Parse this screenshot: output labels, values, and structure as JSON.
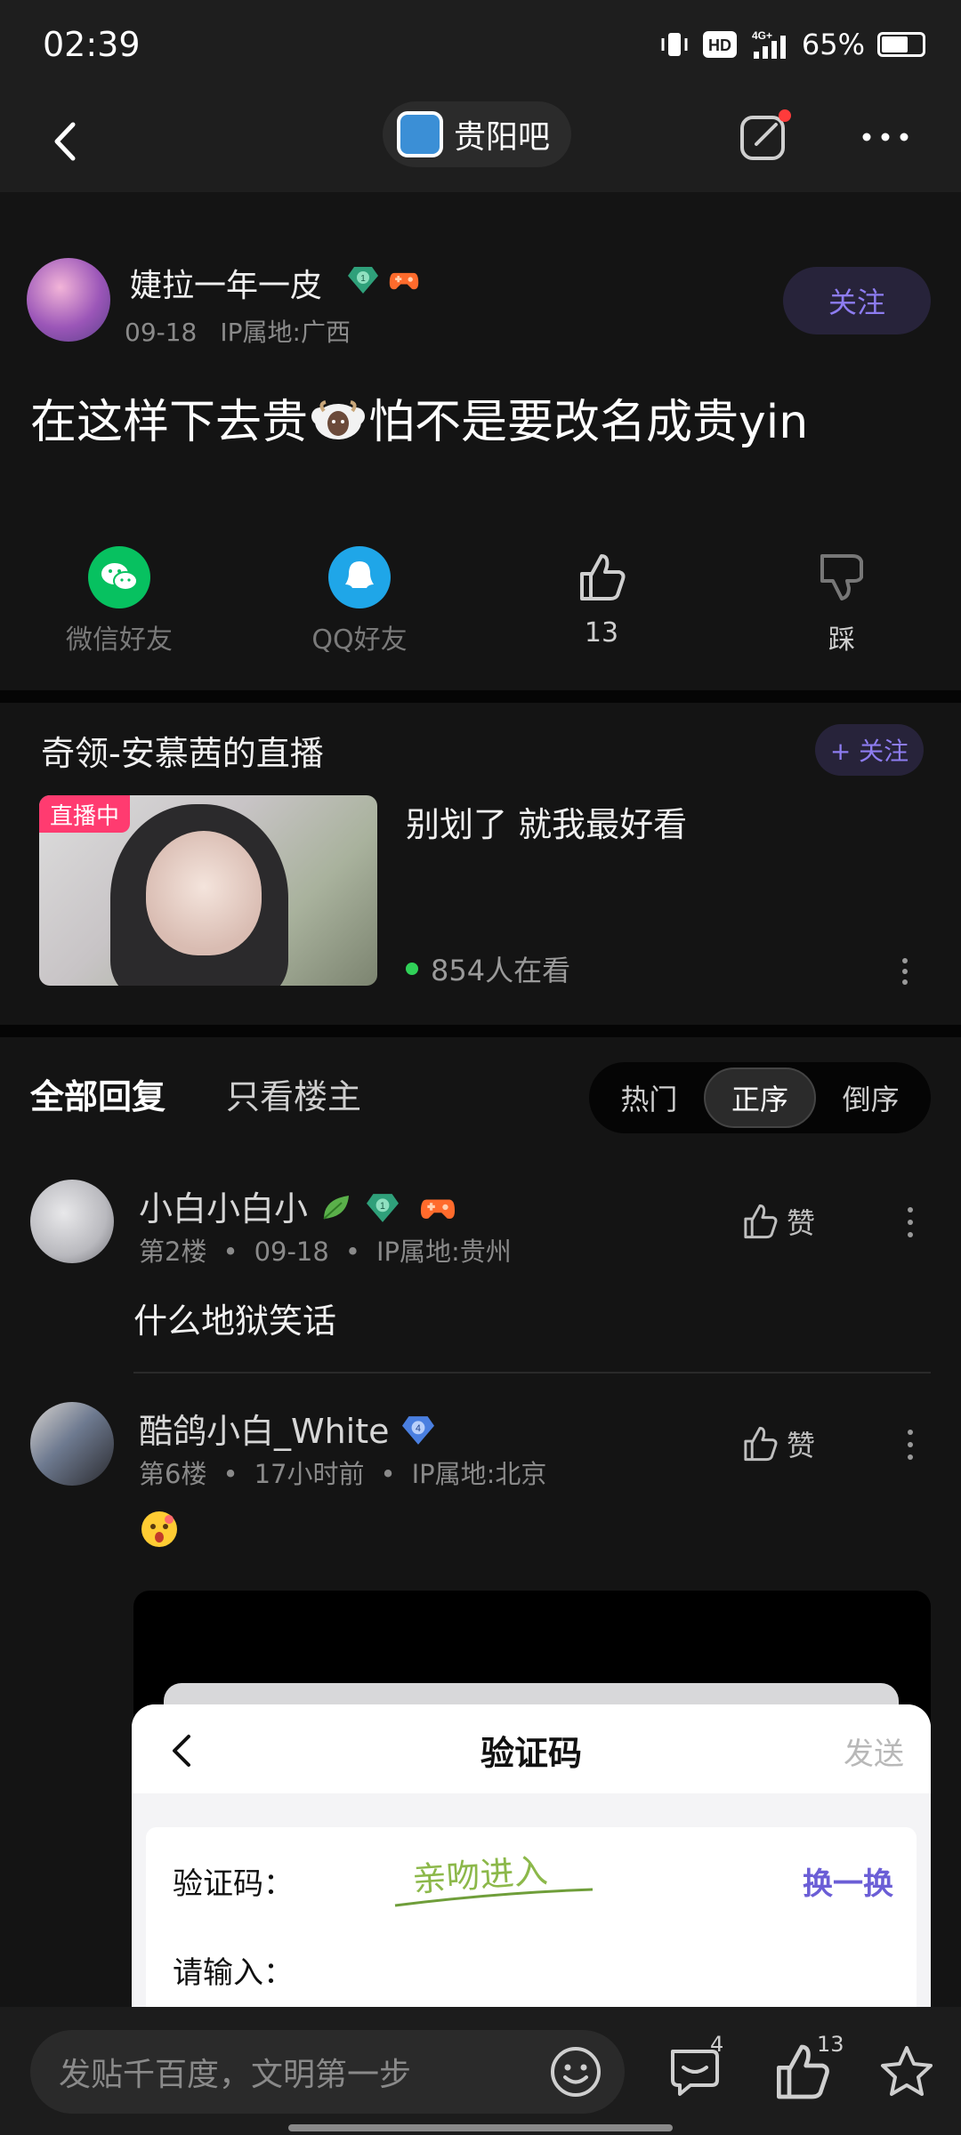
{
  "status_bar": {
    "time": "02:39",
    "network": "4G+",
    "hd": "HD",
    "battery": "65%"
  },
  "nav": {
    "forum_name": "贵阳吧"
  },
  "post": {
    "author": "婕拉一年一皮",
    "level_badge": "1",
    "date": "09-18",
    "ip": "IP属地:广西",
    "follow_label": "关注",
    "title_before": "在这样下去贵",
    "title_after": "怕不是要改名成贵yin",
    "actions": {
      "wechat": "微信好友",
      "qq": "QQ好友",
      "like_count": "13",
      "dislike": "踩"
    }
  },
  "live": {
    "title": "奇领-安慕茜的直播",
    "follow_label": "+ 关注",
    "tag": "直播中",
    "desc": "别划了 就我最好看",
    "viewers": "854人在看"
  },
  "replies": {
    "tabs": {
      "all": "全部回复",
      "op_only": "只看楼主"
    },
    "sort": {
      "hot": "热门",
      "asc": "正序",
      "desc": "倒序",
      "active": "asc"
    },
    "items": [
      {
        "name": "小白小白小",
        "level": "1",
        "floor": "第2楼",
        "time": "09-18",
        "ip": "IP属地:贵州",
        "like_label": "赞",
        "text": "什么地狱笑话"
      },
      {
        "name": "酷鸽小白_White",
        "level": "4",
        "floor": "第6楼",
        "time": "17小时前",
        "ip": "IP属地:北京",
        "like_label": "赞"
      }
    ]
  },
  "captcha_modal": {
    "title": "验证码",
    "send_label": "发送",
    "captcha_label": "验证码：",
    "captcha_text": "亲吻进入",
    "refresh_label": "换一换",
    "input_label": "请输入："
  },
  "bottom_bar": {
    "placeholder": "发贴千百度，文明第一步",
    "comment_count": "4",
    "like_count": "13"
  },
  "colors": {
    "accent": "#8d7cf0",
    "live_tag": "#ff3b70",
    "online": "#30d158"
  }
}
